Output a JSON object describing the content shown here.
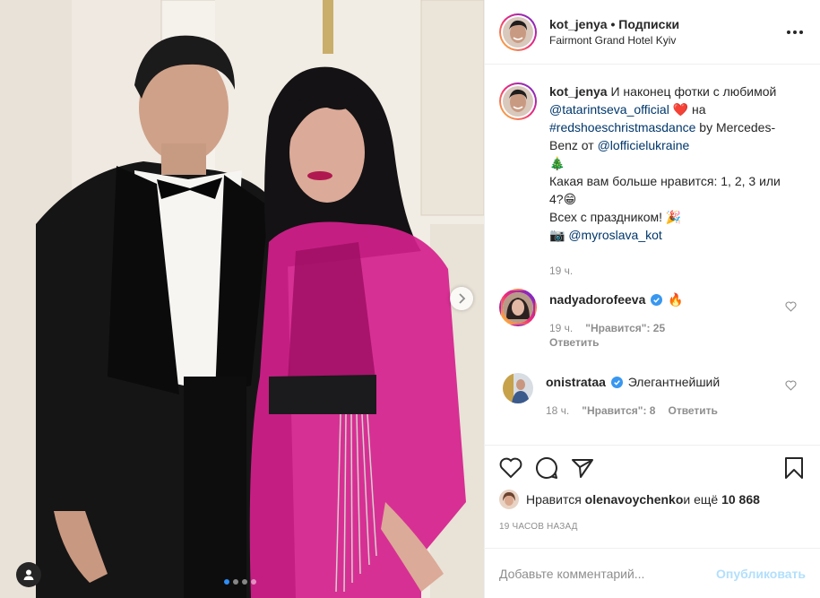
{
  "header": {
    "username": "kot_jenya",
    "separator": " • ",
    "follow_label": "Подписки",
    "location": "Fairmont Grand Hotel Kyiv",
    "more_icon": "more-horizontal-icon"
  },
  "caption": {
    "username": "kot_jenya",
    "text_1": " И наконец фотки с любимой ",
    "mention_1": "@tatarintseva_official",
    "emoji_1": "❤️",
    "text_2": " на ",
    "hashtag": "#redshoeschristmasdance",
    "text_3": " by Mercedes-Benz от ",
    "mention_2": "@lofficielukraine",
    "emoji_2": "🎄",
    "line_2": "Какая вам больше нравится: 1, 2, 3 или 4?",
    "emoji_3": "😁",
    "line_3": "Всех с праздником! ",
    "emoji_4": "🎉",
    "camera": "📷",
    "mention_3": "@myroslava_kot",
    "time": "19 ч."
  },
  "comments": [
    {
      "username": "nadyadorofeeva",
      "verified": true,
      "text": "🔥",
      "time": "19 ч.",
      "likes_label": "\"Нравится\": 25",
      "reply_label": "Ответить"
    },
    {
      "username": "onistrataa",
      "verified": true,
      "text": "Элегантнейший",
      "time": "18 ч.",
      "likes_label": "\"Нравится\": 8",
      "reply_label": "Ответить"
    }
  ],
  "likes": {
    "prefix": "Нравится ",
    "user": "olenavoychenko",
    "middle": " и ещё ",
    "count": "10 868"
  },
  "posted_ago": "19 ЧАСОВ НАЗАД",
  "comment_box": {
    "placeholder": "Добавьте комментарий...",
    "publish_label": "Опубликовать"
  },
  "carousel": {
    "total": 4,
    "current": 1
  },
  "colors": {
    "link": "#00376b",
    "muted": "#8e8e8e",
    "publish": "#b2dffc",
    "dot_active": "#2f8ef7",
    "heart_red": "#ed4956"
  }
}
